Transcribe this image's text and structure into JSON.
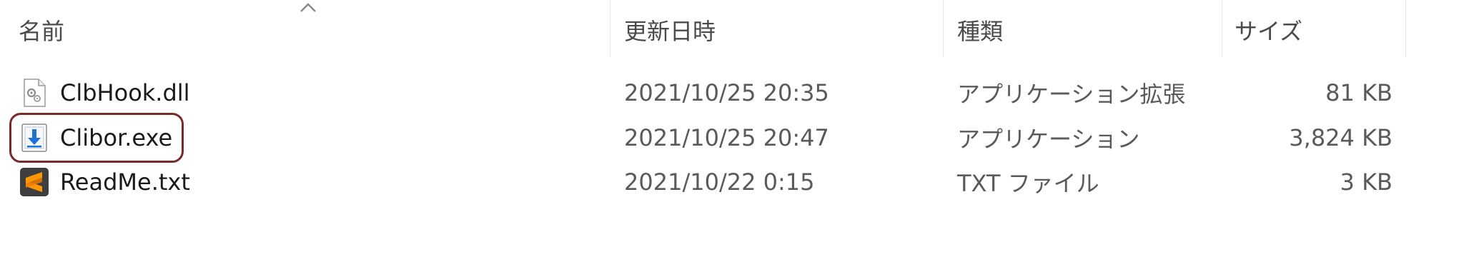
{
  "columns": {
    "name": "名前",
    "modified": "更新日時",
    "type": "種類",
    "size": "サイズ"
  },
  "files": [
    {
      "name": "ClbHook.dll",
      "modified": "2021/10/25 20:35",
      "type": "アプリケーション拡張",
      "size": "81 KB",
      "icon": "dll-file-icon"
    },
    {
      "name": "Clibor.exe",
      "modified": "2021/10/25 20:47",
      "type": "アプリケーション",
      "size": "3,824 KB",
      "icon": "installer-exe-icon"
    },
    {
      "name": "ReadMe.txt",
      "modified": "2021/10/22 0:15",
      "type": "TXT ファイル",
      "size": "3 KB",
      "icon": "sublime-text-icon"
    }
  ],
  "sort": {
    "column": "name",
    "direction": "ascending"
  },
  "highlight": {
    "target": "Clibor.exe",
    "color": "#7a2a2a"
  }
}
